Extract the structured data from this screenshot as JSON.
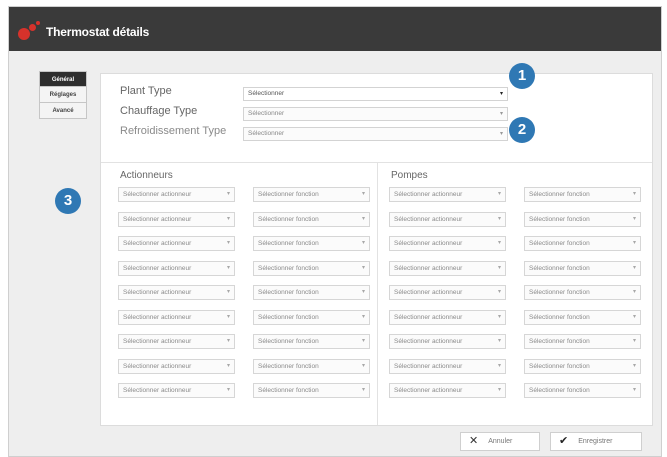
{
  "window": {
    "title": "Thermostat détails"
  },
  "tabs": [
    "Général",
    "Réglages",
    "Avancé"
  ],
  "form": {
    "plant_type": {
      "label": "Plant Type",
      "value": "Sélectionner"
    },
    "chauffage_type": {
      "label": "Chauffage Type",
      "value": "Sélectionner"
    },
    "refroidissement_type": {
      "label": "Refroidissement Type",
      "value": "Sélectionner"
    }
  },
  "sections": {
    "actionneurs": {
      "title": "Actionneurs",
      "rows": [
        {
          "actionneur": "Sélectionner actionneur",
          "fonction": "Sélectionner fonction"
        },
        {
          "actionneur": "Sélectionner actionneur",
          "fonction": "Sélectionner fonction"
        },
        {
          "actionneur": "Sélectionner actionneur",
          "fonction": "Sélectionner fonction"
        },
        {
          "actionneur": "Sélectionner actionneur",
          "fonction": "Sélectionner fonction"
        },
        {
          "actionneur": "Sélectionner actionneur",
          "fonction": "Sélectionner fonction"
        },
        {
          "actionneur": "Sélectionner actionneur",
          "fonction": "Sélectionner fonction"
        },
        {
          "actionneur": "Sélectionner actionneur",
          "fonction": "Sélectionner fonction"
        },
        {
          "actionneur": "Sélectionner actionneur",
          "fonction": "Sélectionner fonction"
        },
        {
          "actionneur": "Sélectionner actionneur",
          "fonction": "Sélectionner fonction"
        }
      ]
    },
    "pompes": {
      "title": "Pompes",
      "rows": [
        {
          "actionneur": "Sélectionner actionneur",
          "fonction": "Sélectionner fonction"
        },
        {
          "actionneur": "Sélectionner actionneur",
          "fonction": "Sélectionner fonction"
        },
        {
          "actionneur": "Sélectionner actionneur",
          "fonction": "Sélectionner fonction"
        },
        {
          "actionneur": "Sélectionner actionneur",
          "fonction": "Sélectionner fonction"
        },
        {
          "actionneur": "Sélectionner actionneur",
          "fonction": "Sélectionner fonction"
        },
        {
          "actionneur": "Sélectionner actionneur",
          "fonction": "Sélectionner fonction"
        },
        {
          "actionneur": "Sélectionner actionneur",
          "fonction": "Sélectionner fonction"
        },
        {
          "actionneur": "Sélectionner actionneur",
          "fonction": "Sélectionner fonction"
        },
        {
          "actionneur": "Sélectionner actionneur",
          "fonction": "Sélectionner fonction"
        }
      ]
    }
  },
  "callouts": [
    "1",
    "2",
    "3"
  ],
  "buttons": {
    "cancel": "Annuler",
    "save": "Enregistrer"
  },
  "icons": {
    "cancel": "close-icon",
    "save": "checkmark-icon",
    "logo": "app-logo-icon"
  },
  "colors": {
    "titlebar": "#3a3a3a",
    "logo": "#d6322b",
    "callout": "#2f78b4"
  }
}
